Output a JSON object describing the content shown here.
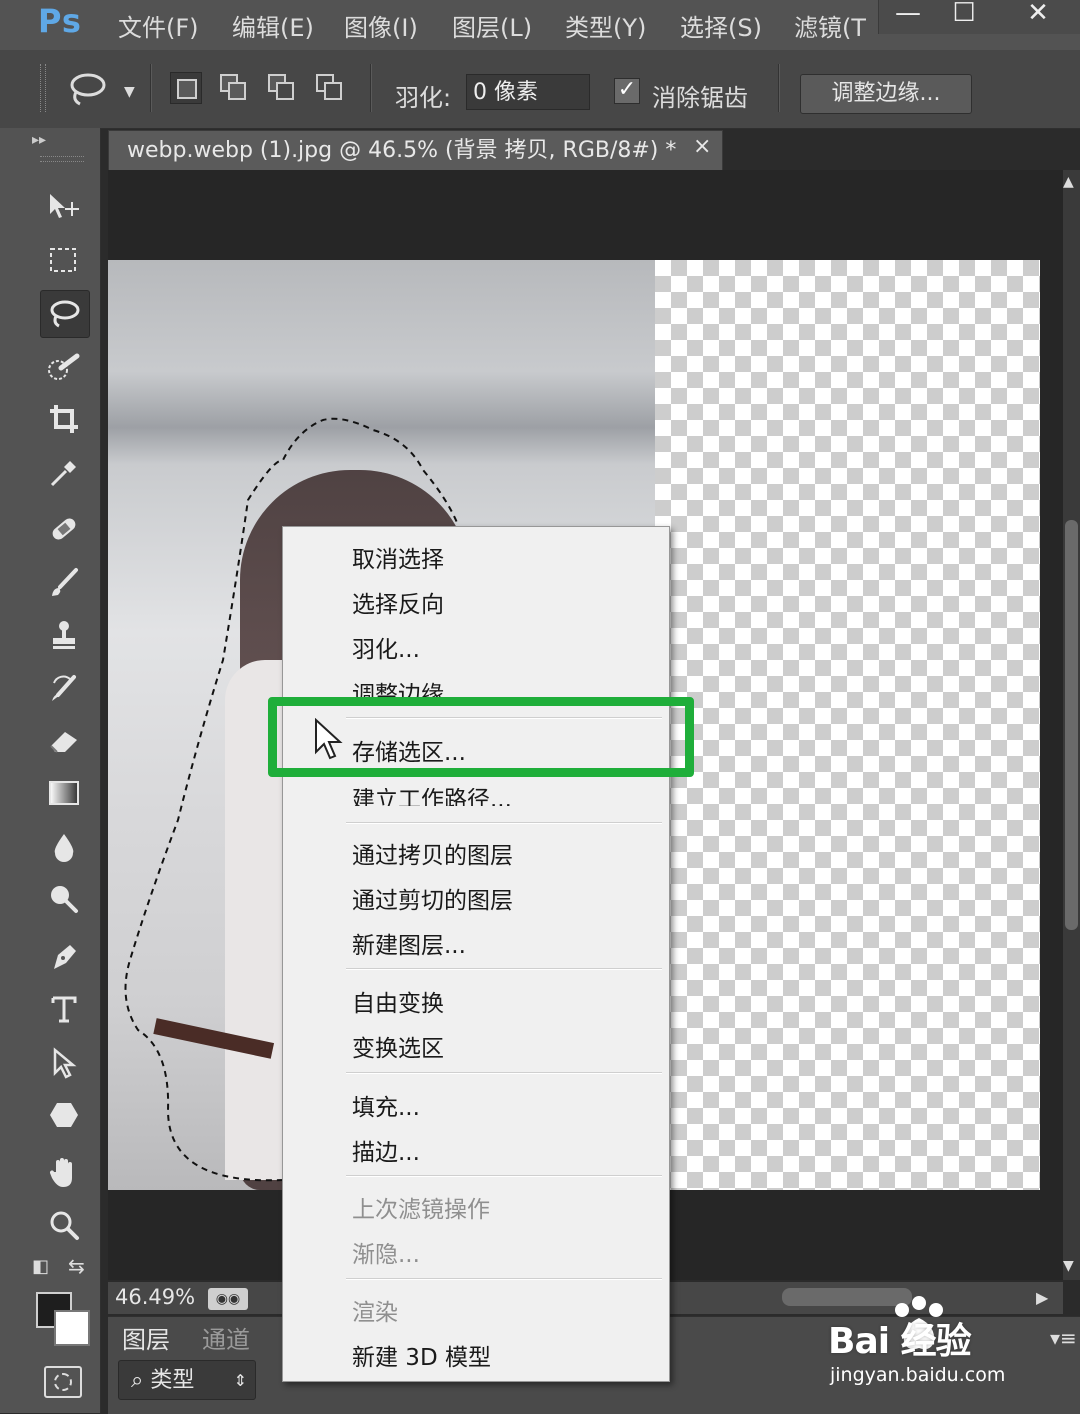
{
  "app": {
    "logo": "Ps"
  },
  "menubar": {
    "items": [
      "文件(F)",
      "编辑(E)",
      "图像(I)",
      "图层(L)",
      "类型(Y)",
      "选择(S)",
      "滤镜(T"
    ]
  },
  "window_controls": {
    "minimize": "—",
    "maximize": "☐",
    "close": "✕"
  },
  "options": {
    "tool_icon": "lasso-icon",
    "feather_label": "羽化:",
    "feather_value": "0 像素",
    "antialias_label": "消除锯齿",
    "antialias_checked": true,
    "refine_edge_label": "调整边缘..."
  },
  "document": {
    "tab_title": "webp.webp (1).jpg @ 46.5% (背景 拷贝, RGB/8#) *",
    "tab_close": "×"
  },
  "tools": [
    "move-icon",
    "marquee-icon",
    "lasso-icon",
    "quick-selection-icon",
    "crop-icon",
    "eyedropper-icon",
    "healing-brush-icon",
    "brush-icon",
    "clone-stamp-icon",
    "history-brush-icon",
    "eraser-icon",
    "gradient-icon",
    "blur-icon",
    "dodge-icon",
    "pen-icon",
    "type-icon",
    "path-selection-icon",
    "shape-icon",
    "hand-icon",
    "zoom-icon"
  ],
  "status": {
    "zoom": "46.49%"
  },
  "layers_panel": {
    "tabs": [
      "图层",
      "通道"
    ],
    "kind_filter": "类型"
  },
  "colors": {
    "foreground": "#1e1e1e",
    "background": "#ffffff",
    "highlight": "#1fae3a"
  },
  "context_menu": {
    "items": [
      {
        "label": "取消选择",
        "enabled": true
      },
      {
        "label": "选择反向",
        "enabled": true
      },
      {
        "label": "羽化...",
        "enabled": true
      },
      {
        "label": "调整边缘...",
        "enabled": true
      },
      {
        "label": "存储选区...",
        "enabled": true,
        "highlighted": true
      },
      {
        "label": "建立工作路径...",
        "enabled": true
      },
      {
        "label": "通过拷贝的图层",
        "enabled": true
      },
      {
        "label": "通过剪切的图层",
        "enabled": true
      },
      {
        "label": "新建图层...",
        "enabled": true
      },
      {
        "label": "自由变换",
        "enabled": true
      },
      {
        "label": "变换选区",
        "enabled": true
      },
      {
        "label": "填充...",
        "enabled": true
      },
      {
        "label": "描边...",
        "enabled": true
      },
      {
        "label": "上次滤镜操作",
        "enabled": false
      },
      {
        "label": "渐隐...",
        "enabled": false
      },
      {
        "label": "渲染",
        "enabled": false
      },
      {
        "label": "新建 3D 模型",
        "enabled": true
      }
    ]
  },
  "watermark": {
    "brand": "Bai 经验",
    "url": "jingyan.baidu.com"
  }
}
